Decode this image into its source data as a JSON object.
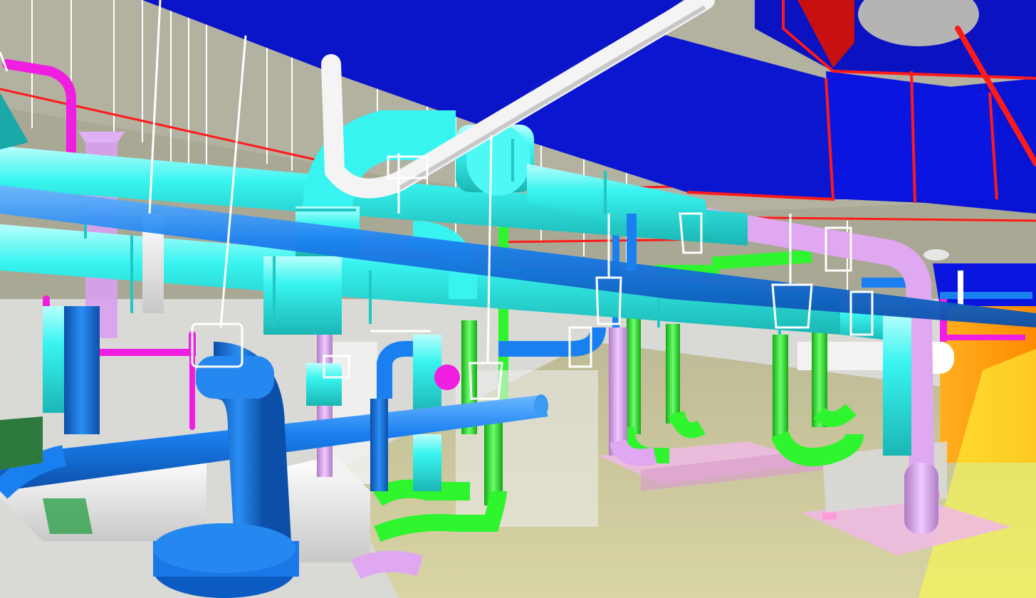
{
  "scene": {
    "kind": "3D BIM model render of a mechanical plant room",
    "systems": [
      {
        "name": "duct",
        "color": "#0a14c8"
      },
      {
        "name": "duct-edge",
        "color": "#ff1a1a"
      },
      {
        "name": "chilled-water-pipe",
        "color": "#33f5f0"
      },
      {
        "name": "condenser-water-pipe",
        "color": "#1a80f0"
      },
      {
        "name": "drain-pipe",
        "color": "#2ef52e"
      },
      {
        "name": "heating-pipe",
        "color": "#e0a8f0"
      },
      {
        "name": "gas-pipe",
        "color": "#f01ee0"
      },
      {
        "name": "sprinkler-main",
        "color": "#ff1a1a"
      },
      {
        "name": "supports",
        "color": "#ffffff"
      }
    ]
  }
}
